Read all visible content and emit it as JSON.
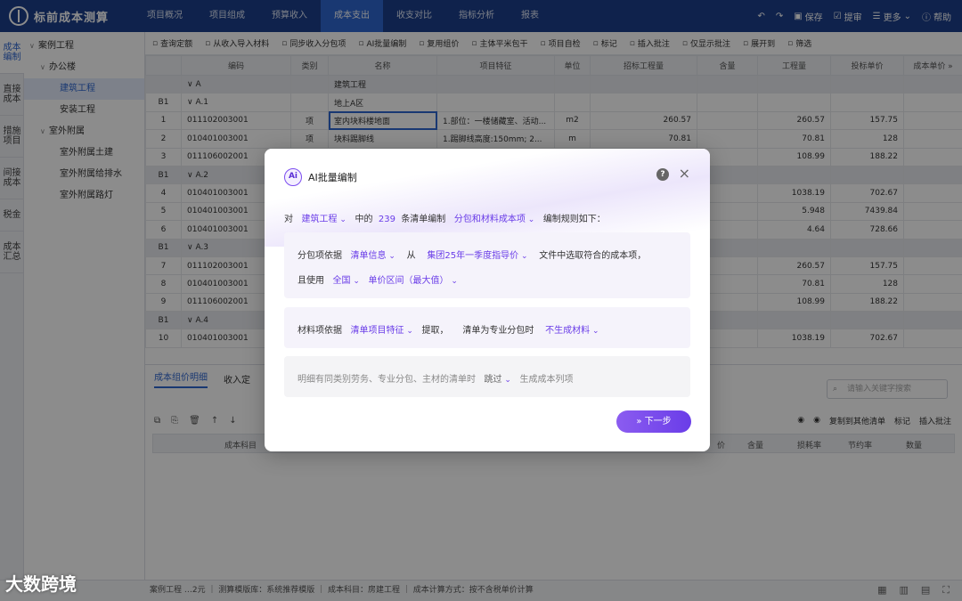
{
  "app": {
    "name": "标前成本测算",
    "nav": [
      "项目概况",
      "项目组成",
      "预算收入",
      "成本支出",
      "收支对比",
      "指标分析",
      "报表"
    ],
    "nav_active": 3,
    "actions": {
      "save": "保存",
      "submit": "提审",
      "more": "更多",
      "help": "帮助"
    }
  },
  "rail": [
    "成本编制",
    "直接成本",
    "措施项目",
    "间接成本",
    "税金",
    "成本汇总"
  ],
  "tree": [
    {
      "label": "案例工程",
      "level": 0,
      "caret": "∨"
    },
    {
      "label": "办公楼",
      "level": 1,
      "caret": "∨"
    },
    {
      "label": "建筑工程",
      "level": 2,
      "caret": ""
    },
    {
      "label": "安装工程",
      "level": 2,
      "caret": ""
    },
    {
      "label": "室外附属",
      "level": 1,
      "caret": "∨"
    },
    {
      "label": "室外附属土建",
      "level": 2,
      "caret": ""
    },
    {
      "label": "室外附属给排水",
      "level": 2,
      "caret": ""
    },
    {
      "label": "室外附属路灯",
      "level": 2,
      "caret": ""
    }
  ],
  "toolbar": [
    "查询定额",
    "从收入导入材料",
    "同步收入分包项",
    "AI批量编制",
    "复用组价",
    "主体平米包干",
    "项目自检",
    "标记",
    "插入批注",
    "仅显示批注",
    "展开到",
    "筛选"
  ],
  "table": {
    "headers": [
      "",
      "编码",
      "类别",
      "名称",
      "项目特征",
      "单位",
      "招标工程量",
      "含量",
      "工程量",
      "投标单价",
      "成本单价 »"
    ],
    "rows": [
      {
        "group": true,
        "c": [
          "",
          "∨ A",
          "",
          "建筑工程",
          "",
          "",
          "",
          "",
          "",
          "",
          ""
        ]
      },
      {
        "group": false,
        "c": [
          "B1",
          "∨ A.1",
          "",
          "地上A区",
          "",
          "",
          "",
          "",
          "",
          "",
          ""
        ]
      },
      {
        "group": false,
        "c": [
          "1",
          "011102003001",
          "项",
          "室内块料楼地面",
          "1.部位：一楼储藏室、活动...",
          "m2",
          "260.57",
          "",
          "260.57",
          "157.75",
          ""
        ]
      },
      {
        "group": false,
        "c": [
          "2",
          "010401003001",
          "项",
          "块料踢脚线",
          "1.踢脚线高度:150mm; 2...",
          "m",
          "70.81",
          "",
          "70.81",
          "128",
          ""
        ]
      },
      {
        "group": false,
        "c": [
          "3",
          "011106002001",
          "",
          "",
          "",
          "",
          "",
          "",
          "108.99",
          "188.22",
          ""
        ]
      },
      {
        "group": true,
        "c": [
          "B1",
          "∨ A.2",
          "",
          "",
          "",
          "",
          "",
          "",
          "",
          "",
          ""
        ]
      },
      {
        "group": false,
        "c": [
          "4",
          "010401003001",
          "",
          "",
          "",
          "",
          "",
          "",
          "1038.19",
          "702.67",
          ""
        ]
      },
      {
        "group": false,
        "c": [
          "5",
          "010401003001",
          "",
          "",
          "",
          "",
          "",
          "",
          "5.948",
          "7439.84",
          ""
        ]
      },
      {
        "group": false,
        "c": [
          "6",
          "010401003001",
          "",
          "",
          "",
          "",
          "",
          "",
          "4.64",
          "728.66",
          ""
        ]
      },
      {
        "group": true,
        "c": [
          "B1",
          "∨ A.3",
          "",
          "",
          "",
          "",
          "",
          "",
          "",
          "",
          ""
        ]
      },
      {
        "group": false,
        "c": [
          "7",
          "011102003001",
          "",
          "",
          "",
          "",
          "",
          "",
          "260.57",
          "157.75",
          ""
        ]
      },
      {
        "group": false,
        "c": [
          "8",
          "010401003001",
          "",
          "",
          "",
          "",
          "",
          "",
          "70.81",
          "128",
          ""
        ]
      },
      {
        "group": false,
        "c": [
          "9",
          "011106002001",
          "",
          "",
          "",
          "",
          "",
          "",
          "108.99",
          "188.22",
          ""
        ]
      },
      {
        "group": true,
        "c": [
          "B1",
          "∨ A.4",
          "",
          "",
          "",
          "",
          "",
          "",
          "",
          "",
          ""
        ]
      },
      {
        "group": false,
        "c": [
          "10",
          "010401003001",
          "",
          "",
          "",
          "",
          "",
          "",
          "1038.19",
          "702.67",
          ""
        ]
      }
    ]
  },
  "lower": {
    "tabs": [
      "成本组价明细",
      "收入定"
    ],
    "search_placeholder": "请输入关键字搜索",
    "actions": [
      "复制到其他清单",
      "标记",
      "插入批注"
    ],
    "headers": [
      "成本科目",
      "价",
      "含量",
      "损耗率",
      "节约率",
      "数量"
    ]
  },
  "status": "案例工程 …2元 ｜ 测算模版库：系统推荐模版 ｜ 成本科目：房建工程 ｜ 成本计算方式：按不含税单价计算",
  "watermark": "大数跨境",
  "modal": {
    "title": "AI批量编制",
    "line1": {
      "p1": "对",
      "scope": "建筑工程",
      "p2": "中的",
      "count": "239",
      "p3": "条清单编制",
      "target": "分包和材料成本项",
      "p4": "编制规则如下："
    },
    "subcontract": {
      "label": "分包项依据",
      "source": "清单信息",
      "from": "从",
      "file": "集团25年一季度指导价",
      "suffix": "文件中选取符合的成本项，",
      "use": "且使用",
      "region": "全国",
      "price": "单价区间（最大值）"
    },
    "material": {
      "label": "材料项依据",
      "source": "清单项目特征",
      "extract": "提取，",
      "when": "清单为专业分包时",
      "action": "不生成材料"
    },
    "detail": {
      "text": "明细有同类别劳务、专业分包、主材的清单时",
      "action": "跳过",
      "suffix": "生成成本列项"
    },
    "next": "» 下一步"
  }
}
